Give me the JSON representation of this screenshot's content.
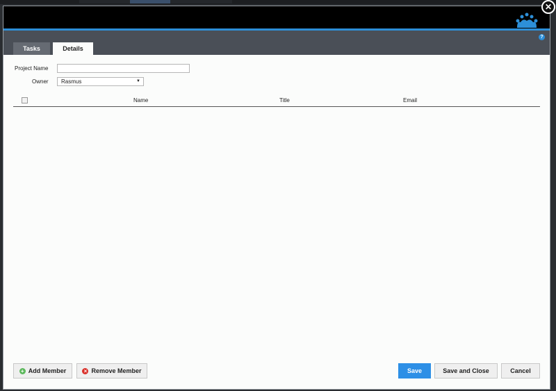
{
  "dialog": {
    "help_glyph": "?",
    "close_glyph": "✕"
  },
  "tabs": [
    {
      "label": "Tasks",
      "active": false
    },
    {
      "label": "Details",
      "active": true
    }
  ],
  "form": {
    "project_name_label": "Project Name",
    "project_name_value": "",
    "owner_label": "Owner",
    "owner_value": "Rasmus"
  },
  "table": {
    "columns": [
      "Name",
      "Title",
      "Email"
    ],
    "rows": []
  },
  "footer": {
    "add_member": "Add Member",
    "remove_member": "Remove Member",
    "save": "Save",
    "save_and_close": "Save and Close",
    "cancel": "Cancel"
  },
  "colors": {
    "accent": "#2d8fd8",
    "header_bg": "#000000",
    "tabbar_bg": "#4a4f57",
    "add_icon": "#5cb85c",
    "remove_icon": "#d9302a"
  },
  "icons": {
    "logo": "crown-logo-icon",
    "add": "plus-circle-icon",
    "remove": "x-circle-icon",
    "help": "help-icon",
    "close": "close-icon"
  }
}
